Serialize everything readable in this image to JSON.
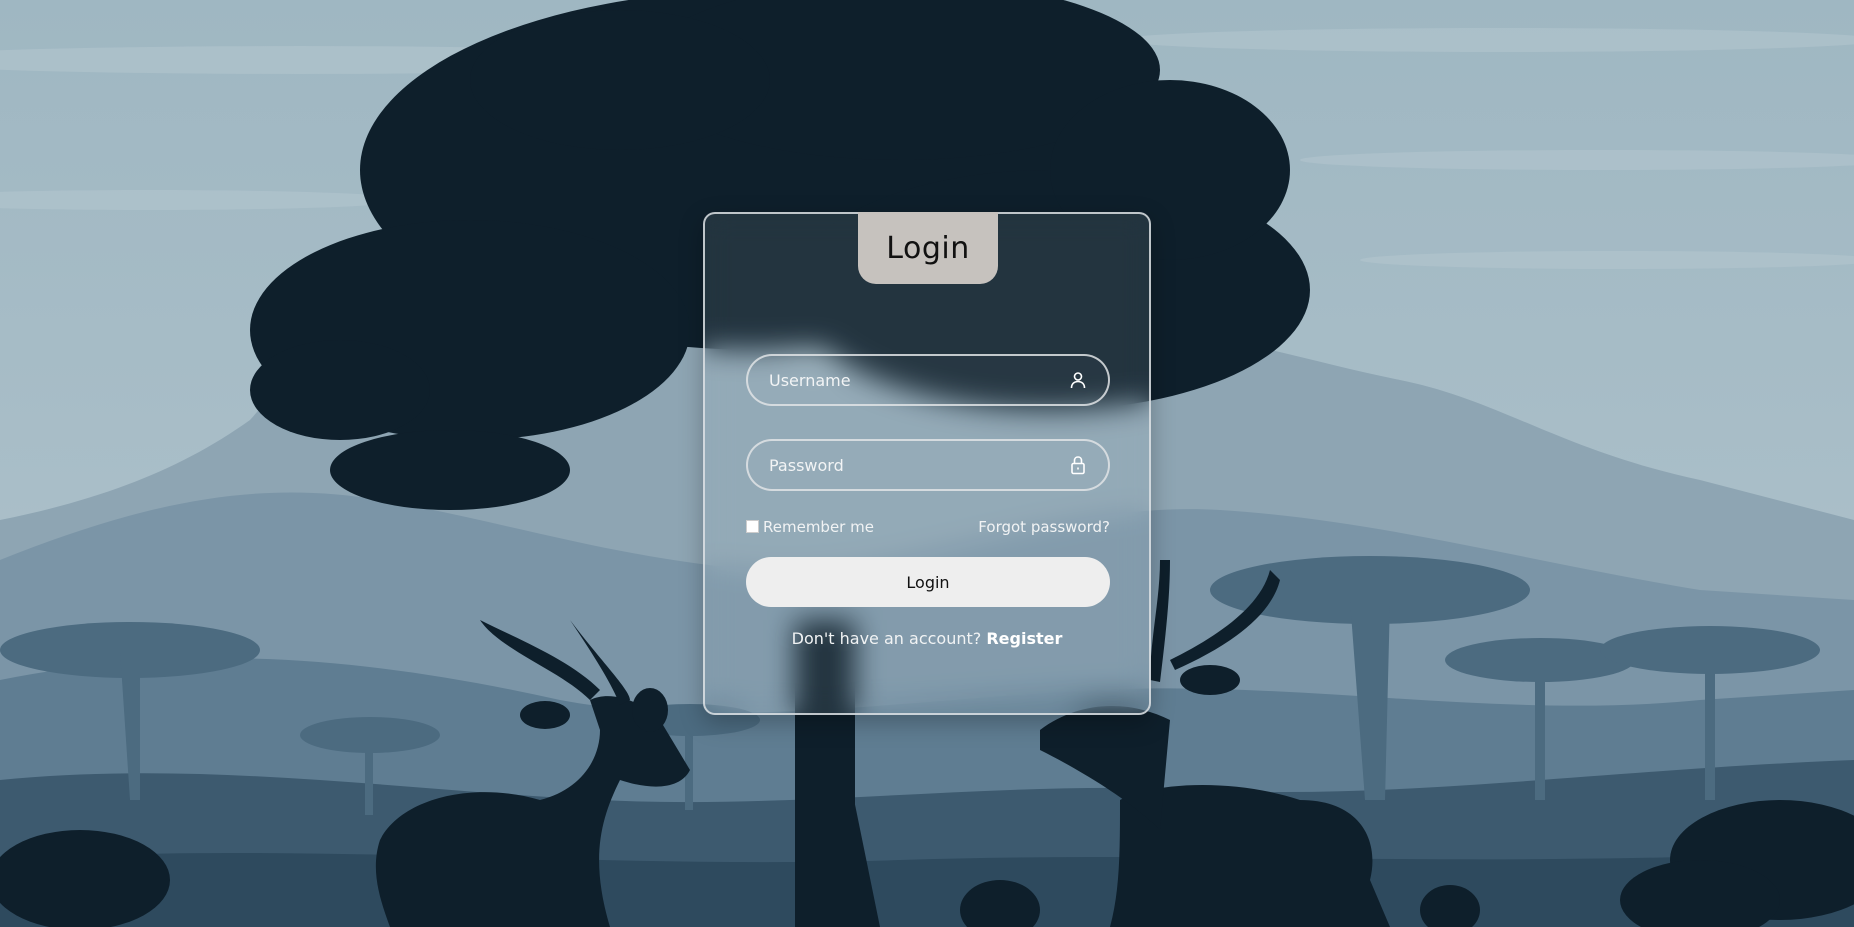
{
  "background": {
    "sky_color": "#a7bcc6",
    "hill_far_color": "#8aa3b1",
    "hill_mid_color": "#7893a5",
    "ground_color": "#3d5a6f",
    "silhouette_color": "#0e1f2b",
    "acacia_color": "#4c6b80"
  },
  "login_card": {
    "title": "Login",
    "username": {
      "placeholder": "Username",
      "icon": "user-icon"
    },
    "password": {
      "placeholder": "Password",
      "icon": "lock-icon"
    },
    "remember_label": "Remember me",
    "forgot_label": "Forgot password?",
    "submit_label": "Login",
    "register_prompt": "Don't have an account?",
    "register_label": "Register"
  }
}
